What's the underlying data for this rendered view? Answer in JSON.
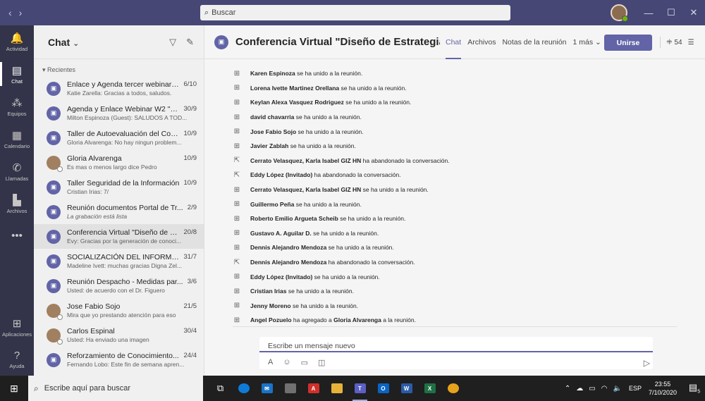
{
  "titlebar": {
    "back": "‹",
    "forward": "›",
    "search_placeholder": "Buscar",
    "minimize": "—",
    "maximize": "☐",
    "close": "✕"
  },
  "rail": {
    "items": [
      {
        "label": "Actividad",
        "icon": "bell-icon",
        "glyph": "🔔"
      },
      {
        "label": "Chat",
        "icon": "chat-icon",
        "glyph": "▤"
      },
      {
        "label": "Equipos",
        "icon": "teams-icon",
        "glyph": "⁂"
      },
      {
        "label": "Calendario",
        "icon": "calendar-icon",
        "glyph": "▦"
      },
      {
        "label": "Llamadas",
        "icon": "phone-icon",
        "glyph": "✆"
      },
      {
        "label": "Archivos",
        "icon": "files-icon",
        "glyph": "▙"
      },
      {
        "label": "",
        "icon": "more-icon",
        "glyph": "•••"
      }
    ],
    "bottom": [
      {
        "label": "Aplicaciones",
        "icon": "apps-icon",
        "glyph": "⊞"
      },
      {
        "label": "Ayuda",
        "icon": "help-icon",
        "glyph": "?"
      }
    ]
  },
  "chatpanel": {
    "title": "Chat",
    "chevron": "⌄",
    "filter_icon": "▽",
    "compose_icon": "✎",
    "section": "Recientes",
    "conversations": [
      {
        "name": "Enlace y Agenda tercer webinar ...",
        "date": "6/10",
        "preview": "Katie Zarella: Gracias a todos, saludos.",
        "type": "meeting"
      },
      {
        "name": "Agenda y Enlace Webinar W2 \"M...",
        "date": "30/9",
        "preview": "Milton Espinoza (Guest): SALUDOS A TOD...",
        "type": "meeting"
      },
      {
        "name": "Taller de Autoevaluación del Con...",
        "date": "10/9",
        "preview": "Gloria Alvarenga: No hay ningun problem...",
        "type": "meeting"
      },
      {
        "name": "Gloria Alvarenga",
        "date": "10/9",
        "preview": "Es mas o menos largo dice Pedro",
        "type": "person"
      },
      {
        "name": "Taller Seguridad de la Información",
        "date": "10/9",
        "preview": "Cristian Irias: 7/",
        "type": "meeting"
      },
      {
        "name": "Reunión documentos Portal de Tr...",
        "date": "2/9",
        "preview": "La grabación está lista",
        "type": "meeting",
        "italic": true
      },
      {
        "name": "Conferencia Virtual \"Diseño de E...",
        "date": "20/8",
        "preview": "Evy: Gracias por la generación de conoci...",
        "type": "meeting",
        "active": true
      },
      {
        "name": "SOCIALIZACIÓN DEL INFORME A...",
        "date": "31/7",
        "preview": "Madeline Ivett: muchas gracias Digna Zel...",
        "type": "meeting"
      },
      {
        "name": "Reunión Despacho - Medidas par...",
        "date": "3/6",
        "preview": "Usted: de acuerdo con el Dr. Figuero",
        "type": "meeting"
      },
      {
        "name": "Jose Fabio Sojo",
        "date": "21/5",
        "preview": "Mira que yo prestando atención para eso",
        "type": "person"
      },
      {
        "name": "Carlos Espinal",
        "date": "30/4",
        "preview": "Usted: Ha enviado una imagen",
        "type": "person"
      },
      {
        "name": "Reforzamiento de Conocimiento...",
        "date": "24/4",
        "preview": "Fernando Lobo: Este fin de semana apren...",
        "type": "meeting"
      }
    ]
  },
  "main": {
    "title": "Conferencia Virtual \"Diseño de Estrategias ...",
    "tabs": [
      {
        "label": "Chat",
        "active": true
      },
      {
        "label": "Archivos"
      },
      {
        "label": "Notas de la reunión"
      },
      {
        "label": "1 más ⌄"
      }
    ],
    "join_label": "Unirse",
    "participants_count": "54",
    "messages": [
      {
        "name": "Karen Espinoza",
        "text": " se ha unido a la reunión.",
        "kind": "join"
      },
      {
        "name": "Lorena Ivette Martinez Orellana",
        "text": " se ha unido a la reunión.",
        "kind": "join"
      },
      {
        "name": "Keylan Alexa Vasquez Rodriguez",
        "text": " se ha unido a la reunión.",
        "kind": "join"
      },
      {
        "name": "david chavarria",
        "text": " se ha unido a la reunión.",
        "kind": "join"
      },
      {
        "name": "Jose Fabio Sojo",
        "text": " se ha unido a la reunión.",
        "kind": "join"
      },
      {
        "name": "Javier Zablah",
        "text": " se ha unido a la reunión.",
        "kind": "join"
      },
      {
        "name": "Cerrato Velasquez, Karla Isabel GIZ HN",
        "text": " ha abandonado la conversación.",
        "kind": "leave"
      },
      {
        "name": "Eddy López (Invitado)",
        "text": " ha abandonado la conversación.",
        "kind": "leave"
      },
      {
        "name": "Cerrato Velasquez, Karla Isabel GIZ HN",
        "text": " se ha unido a la reunión.",
        "kind": "join"
      },
      {
        "name": "Guillermo Peña",
        "text": " se ha unido a la reunión.",
        "kind": "join"
      },
      {
        "name": "Roberto Emilio Argueta Scheib",
        "text": " se ha unido a la reunión.",
        "kind": "join"
      },
      {
        "name": "Gustavo A. Aguilar D.",
        "text": " se ha unido a la reunión.",
        "kind": "join"
      },
      {
        "name": "Dennis Alejandro Mendoza",
        "text": " se ha unido a la reunión.",
        "kind": "join"
      },
      {
        "name": "Dennis Alejandro Mendoza",
        "text": " ha abandonado la conversación.",
        "kind": "leave"
      },
      {
        "name": "Eddy López (Invitado)",
        "text": " se ha unido a la reunión.",
        "kind": "join"
      },
      {
        "name": "Cristian Irias",
        "text": " se ha unido a la reunión.",
        "kind": "join"
      },
      {
        "name": "Jenny Moreno",
        "text": " se ha unido a la reunión.",
        "kind": "join"
      },
      {
        "name": "Angel Pozuelo",
        "text": " ha agregado a ",
        "kind": "join",
        "target": "Gloria Alvarenga",
        "suffix": " a la reunión."
      }
    ],
    "compose_placeholder": "Escribe un mensaje nuevo"
  },
  "taskbar": {
    "search_placeholder": "Escribe aquí para buscar",
    "language": "ESP",
    "time": "23:55",
    "date": "7/10/2020",
    "notifications": "5"
  },
  "colors": {
    "accent": "#6264a7",
    "titlebar": "#464775",
    "rail": "#33344a"
  }
}
